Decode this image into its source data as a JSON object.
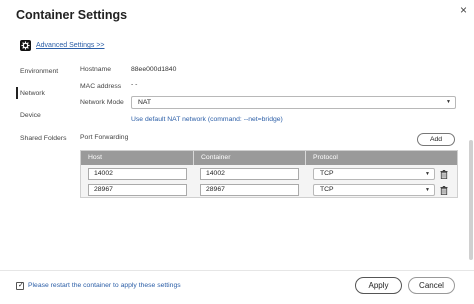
{
  "dialog": {
    "title": "Container Settings",
    "close_glyph": "×"
  },
  "advanced": {
    "label": "Advanced Settings >>",
    "icon": "gear-icon"
  },
  "sidebar": {
    "items": [
      {
        "label": "Environment",
        "active": false
      },
      {
        "label": "Network",
        "active": true
      },
      {
        "label": "Device",
        "active": false
      },
      {
        "label": "Shared Folders",
        "active": false
      }
    ]
  },
  "network": {
    "hostname_label": "Hostname",
    "hostname_value": "88ee000d1840",
    "mac_label": "MAC address",
    "mac_value": "- -",
    "mode_label": "Network Mode",
    "mode_value": "NAT",
    "nat_hint": "Use default NAT network (command: --net=bridge)",
    "port_forwarding_label": "Port Forwarding",
    "add_label": "Add"
  },
  "port_table": {
    "headers": [
      "Host",
      "Container",
      "Protocol"
    ],
    "rows": [
      {
        "host": "14002",
        "container": "14002",
        "protocol": "TCP"
      },
      {
        "host": "28967",
        "container": "28967",
        "protocol": "TCP"
      }
    ]
  },
  "footer": {
    "restart_label": "Please restart the container to apply these settings",
    "restart_checked": true,
    "apply_label": "Apply",
    "cancel_label": "Cancel"
  },
  "colors": {
    "link": "#2b5ea7",
    "table_header": "#9a9a9a"
  }
}
